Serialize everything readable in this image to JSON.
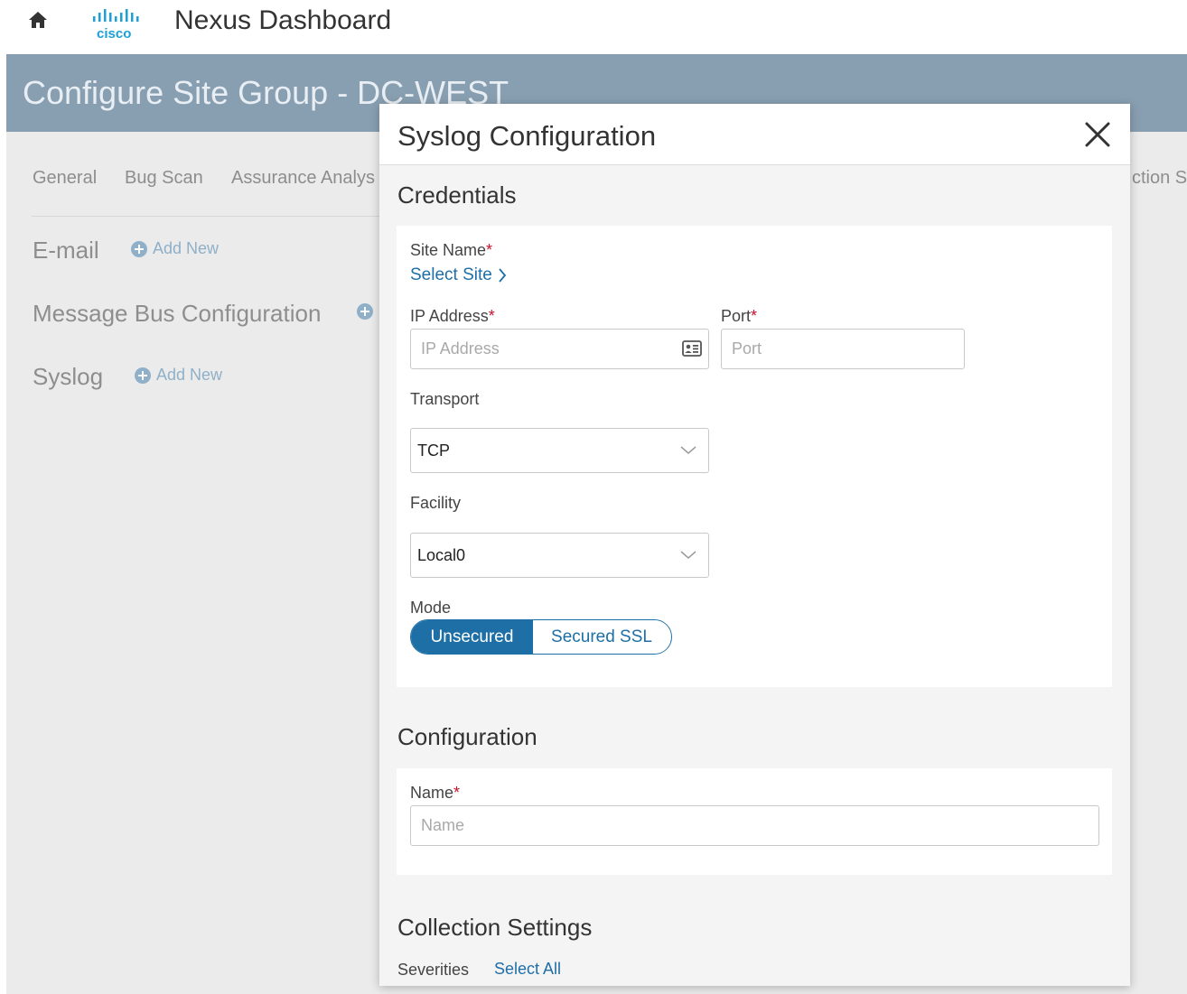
{
  "app": {
    "title": "Nexus Dashboard",
    "logo_text": "cisco"
  },
  "page": {
    "title": "Configure Site Group - DC-WEST",
    "tabs": [
      "General",
      "Bug Scan",
      "Assurance Analys",
      "ction S"
    ],
    "sections": [
      {
        "label": "E-mail",
        "action": "Add New"
      },
      {
        "label": "Message Bus Configuration"
      },
      {
        "label": "Syslog",
        "action": "Add New"
      }
    ]
  },
  "modal": {
    "title": "Syslog Configuration",
    "credentials": {
      "heading": "Credentials",
      "site_name": {
        "label": "Site Name",
        "required": "*",
        "link": "Select Site"
      },
      "ip_address": {
        "label": "IP Address",
        "required": "*",
        "placeholder": "IP Address",
        "value": ""
      },
      "port": {
        "label": "Port",
        "required": "*",
        "placeholder": "Port",
        "value": ""
      },
      "transport": {
        "label": "Transport",
        "value": "TCP"
      },
      "facility": {
        "label": "Facility",
        "value": "Local0"
      },
      "mode": {
        "label": "Mode",
        "options": [
          "Unsecured",
          "Secured SSL"
        ],
        "selected": "Unsecured"
      }
    },
    "configuration": {
      "heading": "Configuration",
      "name": {
        "label": "Name",
        "required": "*",
        "placeholder": "Name",
        "value": ""
      }
    },
    "collection": {
      "heading": "Collection Settings",
      "severities_label": "Severities",
      "select_all": "Select All"
    }
  },
  "icons": [
    "home-icon",
    "cisco-logo",
    "plus-circle-icon",
    "close-icon",
    "address-book-icon",
    "chevron-right-icon",
    "chevron-down-icon"
  ],
  "colors": {
    "header": "#889fb1",
    "accent": "#1d6fa5",
    "required": "#c8102e"
  }
}
